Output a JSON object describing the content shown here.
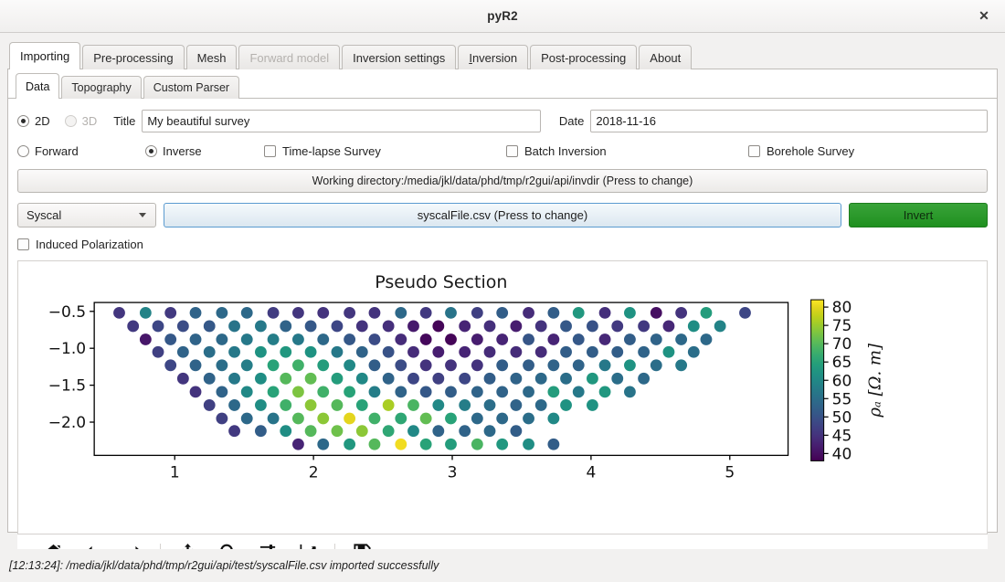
{
  "window": {
    "title": "pyR2",
    "close_label": "✕"
  },
  "main_tabs": [
    {
      "label": "Importing",
      "active": true,
      "disabled": false,
      "mnemonic": null
    },
    {
      "label": "Pre-processing",
      "active": false,
      "disabled": false,
      "mnemonic": null
    },
    {
      "label": "Mesh",
      "active": false,
      "disabled": false,
      "mnemonic": null
    },
    {
      "label": "Forward model",
      "active": false,
      "disabled": true,
      "mnemonic": null
    },
    {
      "label": "Inversion settings",
      "active": false,
      "disabled": false,
      "mnemonic": null
    },
    {
      "label": "Inversion",
      "active": false,
      "disabled": false,
      "mnemonic": "I"
    },
    {
      "label": "Post-processing",
      "active": false,
      "disabled": false,
      "mnemonic": null
    },
    {
      "label": "About",
      "active": false,
      "disabled": false,
      "mnemonic": null
    }
  ],
  "sub_tabs": [
    {
      "label": "Data",
      "active": true
    },
    {
      "label": "Topography",
      "active": false
    },
    {
      "label": "Custom Parser",
      "active": false
    }
  ],
  "form": {
    "dim_2d_label": "2D",
    "dim_3d_label": "3D",
    "dim_selected": "2D",
    "dim_3d_disabled": true,
    "title_label": "Title",
    "title_value": "My beautiful survey",
    "title_placeholder": "",
    "date_label": "Date",
    "date_value": "2018-11-16",
    "date_placeholder": "",
    "forward_label": "Forward",
    "inverse_label": "Inverse",
    "mode_selected": "Inverse",
    "timelapse_label": "Time-lapse Survey",
    "timelapse_checked": false,
    "batch_label": "Batch Inversion",
    "batch_checked": false,
    "borehole_label": "Borehole Survey",
    "borehole_checked": false,
    "working_dir_label": "Working directory:/media/jkl/data/phd/tmp/r2gui/api/invdir (Press to change)",
    "parser_value": "Syscal",
    "file_button_label": "syscalFile.csv (Press to change)",
    "invert_label": "Invert",
    "ip_label": "Induced Polarization",
    "ip_checked": false
  },
  "toolbar": {
    "items": [
      {
        "name": "home-icon",
        "tooltip": "Home"
      },
      {
        "name": "arrow-left-icon",
        "tooltip": "Back"
      },
      {
        "name": "arrow-right-icon",
        "tooltip": "Forward"
      },
      {
        "name": "separator",
        "tooltip": ""
      },
      {
        "name": "move-icon",
        "tooltip": "Pan"
      },
      {
        "name": "magnifier-icon",
        "tooltip": "Zoom"
      },
      {
        "name": "sliders-icon",
        "tooltip": "Configure subplots"
      },
      {
        "name": "chart-line-icon",
        "tooltip": "Edit axis"
      },
      {
        "name": "separator",
        "tooltip": ""
      },
      {
        "name": "floppy-disk-icon",
        "tooltip": "Save"
      }
    ]
  },
  "status": {
    "message": "[12:13:24]: /media/jkl/data/phd/tmp/r2gui/api/test/syscalFile.csv imported successfully"
  },
  "colors": {
    "accent_green": "#2b9b2b",
    "file_blue": "#5b9bd0",
    "window_bg": "#f2f1f0",
    "panel_bg": "#ffffff"
  },
  "chart_data": {
    "type": "scatter",
    "title": "Pseudo Section",
    "xlabel": "",
    "ylabel": "",
    "xlim": [
      0.42,
      5.42
    ],
    "ylim": [
      -2.45,
      -0.38
    ],
    "xticks": [
      1,
      2,
      3,
      4,
      5
    ],
    "yticks": [
      -0.5,
      -1.0,
      -1.5,
      -2.0
    ],
    "ytick_labels": [
      "−0.5",
      "−1.0",
      "−1.5",
      "−2.0"
    ],
    "xtick_labels": [
      "1",
      "2",
      "3",
      "4",
      "5"
    ],
    "grid": false,
    "marker_size": 11,
    "colormap": "viridis",
    "colorbar": {
      "label": "ρₐ [Ω. m]",
      "vmin": 38,
      "vmax": 82,
      "ticks": [
        40,
        45,
        50,
        55,
        60,
        65,
        70,
        75,
        80
      ],
      "tick_labels": [
        "40",
        "45",
        "50",
        "55",
        "60",
        "65",
        "70",
        "75",
        "80"
      ],
      "position": "right"
    },
    "levels": [
      -0.52,
      -0.7,
      -0.88,
      -1.05,
      -1.23,
      -1.41,
      -1.59,
      -1.77,
      -1.95,
      -2.12,
      -2.3
    ],
    "dx": 0.185,
    "points": [
      {
        "x": 0.6,
        "y": -0.52,
        "v": 45.5
      },
      {
        "x": 0.79,
        "y": -0.52,
        "v": 59.0
      },
      {
        "x": 0.97,
        "y": -0.52,
        "v": 46.0
      },
      {
        "x": 1.15,
        "y": -0.52,
        "v": 53.0
      },
      {
        "x": 1.34,
        "y": -0.52,
        "v": 54.0
      },
      {
        "x": 1.52,
        "y": -0.52,
        "v": 54.0
      },
      {
        "x": 1.71,
        "y": -0.52,
        "v": 46.5
      },
      {
        "x": 1.89,
        "y": -0.52,
        "v": 45.5
      },
      {
        "x": 2.07,
        "y": -0.52,
        "v": 45.0
      },
      {
        "x": 2.26,
        "y": -0.52,
        "v": 45.5
      },
      {
        "x": 2.44,
        "y": -0.52,
        "v": 45.0
      },
      {
        "x": 2.63,
        "y": -0.52,
        "v": 54.0
      },
      {
        "x": 2.81,
        "y": -0.52,
        "v": 46.0
      },
      {
        "x": 2.99,
        "y": -0.52,
        "v": 56.0
      },
      {
        "x": 3.18,
        "y": -0.52,
        "v": 47.0
      },
      {
        "x": 3.36,
        "y": -0.52,
        "v": 52.0
      },
      {
        "x": 3.55,
        "y": -0.52,
        "v": 44.0
      },
      {
        "x": 3.73,
        "y": -0.52,
        "v": 52.0
      },
      {
        "x": 3.91,
        "y": -0.52,
        "v": 63.0
      },
      {
        "x": 4.1,
        "y": -0.52,
        "v": 44.5
      },
      {
        "x": 4.28,
        "y": -0.52,
        "v": 62.0
      },
      {
        "x": 4.47,
        "y": -0.52,
        "v": 40.0
      },
      {
        "x": 4.65,
        "y": -0.52,
        "v": 45.0
      },
      {
        "x": 4.83,
        "y": -0.52,
        "v": 64.0
      },
      {
        "x": 5.11,
        "y": -0.52,
        "v": 48.0
      },
      {
        "x": 0.7,
        "y": -0.7,
        "v": 46.0
      },
      {
        "x": 0.88,
        "y": -0.7,
        "v": 48.0
      },
      {
        "x": 1.06,
        "y": -0.7,
        "v": 49.0
      },
      {
        "x": 1.25,
        "y": -0.7,
        "v": 51.0
      },
      {
        "x": 1.43,
        "y": -0.7,
        "v": 56.0
      },
      {
        "x": 1.62,
        "y": -0.7,
        "v": 57.0
      },
      {
        "x": 1.8,
        "y": -0.7,
        "v": 53.0
      },
      {
        "x": 1.98,
        "y": -0.7,
        "v": 51.0
      },
      {
        "x": 2.17,
        "y": -0.7,
        "v": 48.0
      },
      {
        "x": 2.35,
        "y": -0.7,
        "v": 45.0
      },
      {
        "x": 2.54,
        "y": -0.7,
        "v": 44.5
      },
      {
        "x": 2.72,
        "y": -0.7,
        "v": 41.5
      },
      {
        "x": 2.9,
        "y": -0.7,
        "v": 38.5
      },
      {
        "x": 3.09,
        "y": -0.7,
        "v": 43.0
      },
      {
        "x": 3.27,
        "y": -0.7,
        "v": 44.5
      },
      {
        "x": 3.46,
        "y": -0.7,
        "v": 42.0
      },
      {
        "x": 3.64,
        "y": -0.7,
        "v": 45.0
      },
      {
        "x": 3.82,
        "y": -0.7,
        "v": 51.0
      },
      {
        "x": 4.01,
        "y": -0.7,
        "v": 50.0
      },
      {
        "x": 4.19,
        "y": -0.7,
        "v": 46.0
      },
      {
        "x": 4.38,
        "y": -0.7,
        "v": 46.0
      },
      {
        "x": 4.56,
        "y": -0.7,
        "v": 43.5
      },
      {
        "x": 4.74,
        "y": -0.7,
        "v": 61.0
      },
      {
        "x": 4.93,
        "y": -0.7,
        "v": 59.0
      },
      {
        "x": 0.79,
        "y": -0.88,
        "v": 41.0
      },
      {
        "x": 0.97,
        "y": -0.88,
        "v": 51.0
      },
      {
        "x": 1.15,
        "y": -0.88,
        "v": 53.0
      },
      {
        "x": 1.34,
        "y": -0.88,
        "v": 54.0
      },
      {
        "x": 1.52,
        "y": -0.88,
        "v": 57.0
      },
      {
        "x": 1.71,
        "y": -0.88,
        "v": 58.0
      },
      {
        "x": 1.89,
        "y": -0.88,
        "v": 57.0
      },
      {
        "x": 2.07,
        "y": -0.88,
        "v": 54.0
      },
      {
        "x": 2.26,
        "y": -0.88,
        "v": 51.0
      },
      {
        "x": 2.44,
        "y": -0.88,
        "v": 49.0
      },
      {
        "x": 2.63,
        "y": -0.88,
        "v": 44.0
      },
      {
        "x": 2.81,
        "y": -0.88,
        "v": 39.0
      },
      {
        "x": 2.99,
        "y": -0.88,
        "v": 38.5
      },
      {
        "x": 3.18,
        "y": -0.88,
        "v": 42.0
      },
      {
        "x": 3.36,
        "y": -0.88,
        "v": 43.0
      },
      {
        "x": 3.55,
        "y": -0.88,
        "v": 50.5
      },
      {
        "x": 3.73,
        "y": -0.88,
        "v": 43.0
      },
      {
        "x": 3.91,
        "y": -0.88,
        "v": 51.0
      },
      {
        "x": 4.1,
        "y": -0.88,
        "v": 43.5
      },
      {
        "x": 4.28,
        "y": -0.88,
        "v": 52.0
      },
      {
        "x": 4.47,
        "y": -0.88,
        "v": 53.0
      },
      {
        "x": 4.65,
        "y": -0.88,
        "v": 54.0
      },
      {
        "x": 4.83,
        "y": -0.88,
        "v": 54.0
      },
      {
        "x": 0.88,
        "y": -1.05,
        "v": 47.0
      },
      {
        "x": 1.06,
        "y": -1.05,
        "v": 53.0
      },
      {
        "x": 1.25,
        "y": -1.05,
        "v": 55.0
      },
      {
        "x": 1.43,
        "y": -1.05,
        "v": 57.0
      },
      {
        "x": 1.62,
        "y": -1.05,
        "v": 62.0
      },
      {
        "x": 1.8,
        "y": -1.05,
        "v": 63.0
      },
      {
        "x": 1.98,
        "y": -1.05,
        "v": 62.0
      },
      {
        "x": 2.17,
        "y": -1.05,
        "v": 57.0
      },
      {
        "x": 2.35,
        "y": -1.05,
        "v": 53.0
      },
      {
        "x": 2.54,
        "y": -1.05,
        "v": 50.0
      },
      {
        "x": 2.72,
        "y": -1.05,
        "v": 44.0
      },
      {
        "x": 2.9,
        "y": -1.05,
        "v": 42.0
      },
      {
        "x": 3.09,
        "y": -1.05,
        "v": 43.0
      },
      {
        "x": 3.27,
        "y": -1.05,
        "v": 44.0
      },
      {
        "x": 3.46,
        "y": -1.05,
        "v": 44.0
      },
      {
        "x": 3.64,
        "y": -1.05,
        "v": 44.0
      },
      {
        "x": 3.82,
        "y": -1.05,
        "v": 52.0
      },
      {
        "x": 4.01,
        "y": -1.05,
        "v": 52.0
      },
      {
        "x": 4.19,
        "y": -1.05,
        "v": 52.0
      },
      {
        "x": 4.38,
        "y": -1.05,
        "v": 53.0
      },
      {
        "x": 4.56,
        "y": -1.05,
        "v": 62.0
      },
      {
        "x": 4.74,
        "y": -1.05,
        "v": 55.0
      },
      {
        "x": 0.97,
        "y": -1.23,
        "v": 48.0
      },
      {
        "x": 1.15,
        "y": -1.23,
        "v": 53.0
      },
      {
        "x": 1.34,
        "y": -1.23,
        "v": 55.0
      },
      {
        "x": 1.52,
        "y": -1.23,
        "v": 58.0
      },
      {
        "x": 1.71,
        "y": -1.23,
        "v": 65.0
      },
      {
        "x": 1.89,
        "y": -1.23,
        "v": 68.0
      },
      {
        "x": 2.07,
        "y": -1.23,
        "v": 64.0
      },
      {
        "x": 2.26,
        "y": -1.23,
        "v": 60.0
      },
      {
        "x": 2.44,
        "y": -1.23,
        "v": 52.0
      },
      {
        "x": 2.63,
        "y": -1.23,
        "v": 49.0
      },
      {
        "x": 2.81,
        "y": -1.23,
        "v": 45.0
      },
      {
        "x": 2.99,
        "y": -1.23,
        "v": 45.0
      },
      {
        "x": 3.18,
        "y": -1.23,
        "v": 45.0
      },
      {
        "x": 3.36,
        "y": -1.23,
        "v": 52.0
      },
      {
        "x": 3.55,
        "y": -1.23,
        "v": 52.0
      },
      {
        "x": 3.73,
        "y": -1.23,
        "v": 53.0
      },
      {
        "x": 3.91,
        "y": -1.23,
        "v": 53.0
      },
      {
        "x": 4.1,
        "y": -1.23,
        "v": 57.0
      },
      {
        "x": 4.28,
        "y": -1.23,
        "v": 62.0
      },
      {
        "x": 4.47,
        "y": -1.23,
        "v": 55.0
      },
      {
        "x": 4.65,
        "y": -1.23,
        "v": 57.0
      },
      {
        "x": 1.06,
        "y": -1.41,
        "v": 45.5
      },
      {
        "x": 1.25,
        "y": -1.41,
        "v": 53.0
      },
      {
        "x": 1.43,
        "y": -1.41,
        "v": 57.0
      },
      {
        "x": 1.62,
        "y": -1.41,
        "v": 61.0
      },
      {
        "x": 1.8,
        "y": -1.41,
        "v": 70.0
      },
      {
        "x": 1.98,
        "y": -1.41,
        "v": 71.0
      },
      {
        "x": 2.17,
        "y": -1.41,
        "v": 64.0
      },
      {
        "x": 2.35,
        "y": -1.41,
        "v": 60.0
      },
      {
        "x": 2.54,
        "y": -1.41,
        "v": 53.0
      },
      {
        "x": 2.72,
        "y": -1.41,
        "v": 48.0
      },
      {
        "x": 2.9,
        "y": -1.41,
        "v": 47.0
      },
      {
        "x": 3.09,
        "y": -1.41,
        "v": 48.0
      },
      {
        "x": 3.27,
        "y": -1.41,
        "v": 52.0
      },
      {
        "x": 3.46,
        "y": -1.41,
        "v": 53.0
      },
      {
        "x": 3.64,
        "y": -1.41,
        "v": 54.0
      },
      {
        "x": 3.82,
        "y": -1.41,
        "v": 55.0
      },
      {
        "x": 4.01,
        "y": -1.41,
        "v": 63.0
      },
      {
        "x": 4.19,
        "y": -1.41,
        "v": 55.0
      },
      {
        "x": 4.38,
        "y": -1.41,
        "v": 54.0
      },
      {
        "x": 1.15,
        "y": -1.59,
        "v": 45.0
      },
      {
        "x": 1.34,
        "y": -1.59,
        "v": 53.0
      },
      {
        "x": 1.52,
        "y": -1.59,
        "v": 60.0
      },
      {
        "x": 1.71,
        "y": -1.59,
        "v": 65.0
      },
      {
        "x": 1.89,
        "y": -1.59,
        "v": 73.0
      },
      {
        "x": 2.07,
        "y": -1.59,
        "v": 68.0
      },
      {
        "x": 2.26,
        "y": -1.59,
        "v": 65.0
      },
      {
        "x": 2.44,
        "y": -1.59,
        "v": 58.0
      },
      {
        "x": 2.63,
        "y": -1.59,
        "v": 53.0
      },
      {
        "x": 2.81,
        "y": -1.59,
        "v": 51.0
      },
      {
        "x": 2.99,
        "y": -1.59,
        "v": 52.0
      },
      {
        "x": 3.18,
        "y": -1.59,
        "v": 53.0
      },
      {
        "x": 3.36,
        "y": -1.59,
        "v": 53.0
      },
      {
        "x": 3.55,
        "y": -1.59,
        "v": 54.0
      },
      {
        "x": 3.73,
        "y": -1.59,
        "v": 64.0
      },
      {
        "x": 3.91,
        "y": -1.59,
        "v": 57.0
      },
      {
        "x": 4.1,
        "y": -1.59,
        "v": 63.0
      },
      {
        "x": 4.28,
        "y": -1.59,
        "v": 56.0
      },
      {
        "x": 1.25,
        "y": -1.77,
        "v": 47.0
      },
      {
        "x": 1.43,
        "y": -1.77,
        "v": 54.0
      },
      {
        "x": 1.62,
        "y": -1.77,
        "v": 61.0
      },
      {
        "x": 1.8,
        "y": -1.77,
        "v": 68.0
      },
      {
        "x": 1.98,
        "y": -1.77,
        "v": 74.0
      },
      {
        "x": 2.17,
        "y": -1.77,
        "v": 70.0
      },
      {
        "x": 2.35,
        "y": -1.77,
        "v": 65.0
      },
      {
        "x": 2.54,
        "y": -1.77,
        "v": 76.0
      },
      {
        "x": 2.72,
        "y": -1.77,
        "v": 69.0
      },
      {
        "x": 2.9,
        "y": -1.77,
        "v": 60.0
      },
      {
        "x": 3.09,
        "y": -1.77,
        "v": 58.0
      },
      {
        "x": 3.27,
        "y": -1.77,
        "v": 55.0
      },
      {
        "x": 3.46,
        "y": -1.77,
        "v": 53.0
      },
      {
        "x": 3.64,
        "y": -1.77,
        "v": 54.0
      },
      {
        "x": 3.82,
        "y": -1.77,
        "v": 62.0
      },
      {
        "x": 4.01,
        "y": -1.77,
        "v": 62.0
      },
      {
        "x": 1.34,
        "y": -1.95,
        "v": 47.0
      },
      {
        "x": 1.52,
        "y": -1.95,
        "v": 54.0
      },
      {
        "x": 1.71,
        "y": -1.95,
        "v": 56.0
      },
      {
        "x": 1.89,
        "y": -1.95,
        "v": 70.0
      },
      {
        "x": 2.07,
        "y": -1.95,
        "v": 74.0
      },
      {
        "x": 2.26,
        "y": -1.95,
        "v": 80.0
      },
      {
        "x": 2.44,
        "y": -1.95,
        "v": 68.0
      },
      {
        "x": 2.63,
        "y": -1.95,
        "v": 66.0
      },
      {
        "x": 2.81,
        "y": -1.95,
        "v": 71.0
      },
      {
        "x": 2.99,
        "y": -1.95,
        "v": 65.0
      },
      {
        "x": 3.18,
        "y": -1.95,
        "v": 54.0
      },
      {
        "x": 3.36,
        "y": -1.95,
        "v": 54.0
      },
      {
        "x": 3.55,
        "y": -1.95,
        "v": 55.0
      },
      {
        "x": 3.73,
        "y": -1.95,
        "v": 60.0
      },
      {
        "x": 1.43,
        "y": -2.12,
        "v": 46.0
      },
      {
        "x": 1.62,
        "y": -2.12,
        "v": 52.0
      },
      {
        "x": 1.8,
        "y": -2.12,
        "v": 61.0
      },
      {
        "x": 1.98,
        "y": -2.12,
        "v": 70.0
      },
      {
        "x": 2.17,
        "y": -2.12,
        "v": 72.0
      },
      {
        "x": 2.35,
        "y": -2.12,
        "v": 74.0
      },
      {
        "x": 2.54,
        "y": -2.12,
        "v": 66.0
      },
      {
        "x": 2.72,
        "y": -2.12,
        "v": 60.0
      },
      {
        "x": 2.9,
        "y": -2.12,
        "v": 53.0
      },
      {
        "x": 3.09,
        "y": -2.12,
        "v": 53.0
      },
      {
        "x": 3.27,
        "y": -2.12,
        "v": 54.0
      },
      {
        "x": 3.46,
        "y": -2.12,
        "v": 52.0
      },
      {
        "x": 1.89,
        "y": -2.3,
        "v": 43.0
      },
      {
        "x": 2.07,
        "y": -2.3,
        "v": 54.0
      },
      {
        "x": 2.26,
        "y": -2.3,
        "v": 63.0
      },
      {
        "x": 2.44,
        "y": -2.3,
        "v": 70.0
      },
      {
        "x": 2.63,
        "y": -2.3,
        "v": 81.0
      },
      {
        "x": 2.81,
        "y": -2.3,
        "v": 65.0
      },
      {
        "x": 2.99,
        "y": -2.3,
        "v": 64.0
      },
      {
        "x": 3.18,
        "y": -2.3,
        "v": 69.0
      },
      {
        "x": 3.36,
        "y": -2.3,
        "v": 63.0
      },
      {
        "x": 3.55,
        "y": -2.3,
        "v": 61.0
      },
      {
        "x": 3.73,
        "y": -2.3,
        "v": 52.0
      }
    ]
  }
}
